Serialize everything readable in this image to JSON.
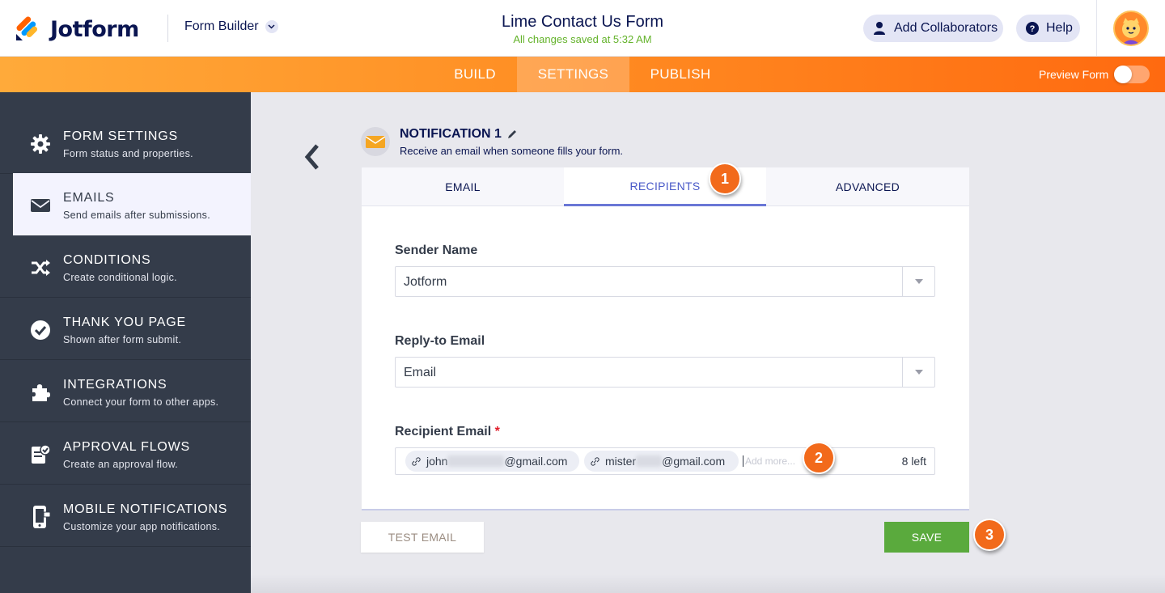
{
  "header": {
    "brand": "Jotform",
    "builder_label": "Form Builder",
    "form_title": "Lime Contact Us Form",
    "save_status": "All changes saved at 5:32 AM",
    "collab_label": "Add Collaborators",
    "help_label": "Help"
  },
  "nav": {
    "tabs": [
      {
        "label": "BUILD",
        "active": false
      },
      {
        "label": "SETTINGS",
        "active": true
      },
      {
        "label": "PUBLISH",
        "active": false
      }
    ],
    "preview_label": "Preview Form",
    "preview_on": false
  },
  "sidebar": {
    "items": [
      {
        "title": "FORM SETTINGS",
        "sub": "Form status and properties.",
        "icon": "gear-icon"
      },
      {
        "title": "EMAILS",
        "sub": "Send emails after submissions.",
        "icon": "envelope-icon",
        "active": true
      },
      {
        "title": "CONDITIONS",
        "sub": "Create conditional logic.",
        "icon": "shuffle-icon"
      },
      {
        "title": "THANK YOU PAGE",
        "sub": "Shown after form submit.",
        "icon": "check-circle-icon"
      },
      {
        "title": "INTEGRATIONS",
        "sub": "Connect your form to other apps.",
        "icon": "puzzle-icon"
      },
      {
        "title": "APPROVAL FLOWS",
        "sub": "Create an approval flow.",
        "icon": "approval-icon"
      },
      {
        "title": "MOBILE NOTIFICATIONS",
        "sub": "Customize your app notifications.",
        "icon": "mobile-icon"
      }
    ]
  },
  "notification": {
    "title": "NOTIFICATION 1",
    "subtitle": "Receive an email when someone fills your form."
  },
  "tabs": [
    {
      "label": "EMAIL",
      "active": false
    },
    {
      "label": "RECIPIENTS",
      "active": true
    },
    {
      "label": "ADVANCED",
      "active": false
    }
  ],
  "fields": {
    "sender_label": "Sender Name",
    "sender_value": "Jotform",
    "reply_label": "Reply-to Email",
    "reply_value": "Email",
    "recipient_label": "Recipient Email",
    "required_mark": "*",
    "recipients": [
      {
        "prefix": "john",
        "domain": "@gmail.com"
      },
      {
        "prefix": "mister",
        "domain": "@gmail.com"
      }
    ],
    "add_more_placeholder": "Add more...",
    "left_count": "8 left"
  },
  "actions": {
    "test_label": "TEST EMAIL",
    "save_label": "SAVE"
  },
  "steps": [
    "1",
    "2",
    "3"
  ],
  "colors": {
    "brand_navy": "#0a1551",
    "orange": "#ff6a10",
    "save_green": "#5aaa3d",
    "tab_accent": "#6a77d6",
    "sidebar_bg": "#343c4a"
  }
}
